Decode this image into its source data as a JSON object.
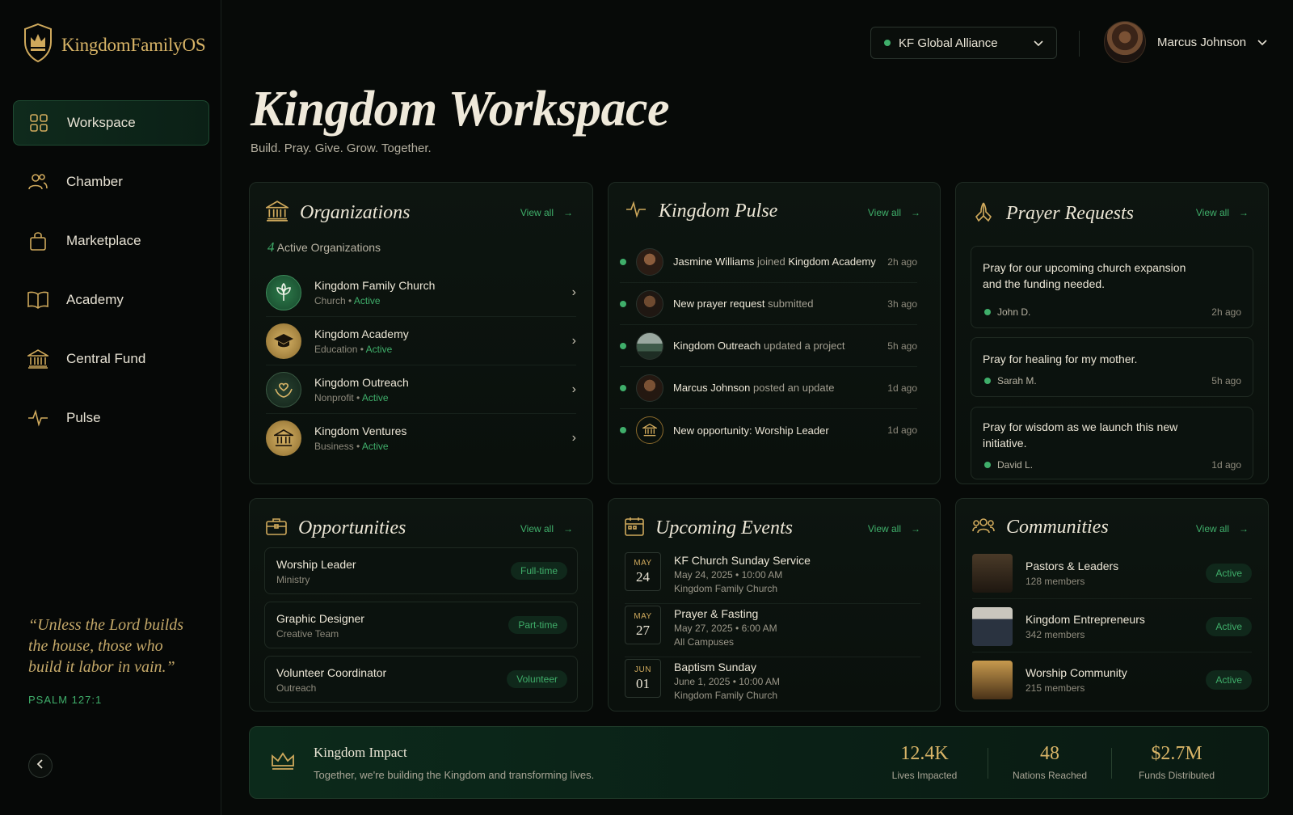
{
  "app": {
    "name": "KingdomFamilyOS",
    "accent": "#cfa95c",
    "green": "#3fae6a"
  },
  "sidebar": {
    "items": [
      {
        "label": "Workspace",
        "icon": "grid-icon",
        "active": true
      },
      {
        "label": "Chamber",
        "icon": "people-icon"
      },
      {
        "label": "Marketplace",
        "icon": "bag-icon"
      },
      {
        "label": "Academy",
        "icon": "book-icon"
      },
      {
        "label": "Central Fund",
        "icon": "bank-icon"
      },
      {
        "label": "Pulse",
        "icon": "pulse-icon"
      }
    ],
    "quote": "“Unless the Lord builds the house, those who build it labor in vain.”",
    "quote_ref": "PSALM 127:1"
  },
  "topbar": {
    "org": "KF Global Alliance",
    "user": "Marcus Johnson"
  },
  "header": {
    "title": "Kingdom Workspace",
    "subtitle": "Build. Pray. Give. Grow. Together."
  },
  "organizations": {
    "title": "Organizations",
    "view_all": "View all",
    "count": "4",
    "count_label": "Active Organizations",
    "items": [
      {
        "name": "Kingdom Family Church",
        "type": "Church",
        "status": "Active"
      },
      {
        "name": "Kingdom Academy",
        "type": "Education",
        "status": "Active"
      },
      {
        "name": "Kingdom Outreach",
        "type": "Nonprofit",
        "status": "Active"
      },
      {
        "name": "Kingdom Ventures",
        "type": "Business",
        "status": "Active"
      }
    ]
  },
  "pulse": {
    "title": "Kingdom Pulse",
    "view_all": "View all",
    "items": [
      {
        "who": "Jasmine Williams",
        "action": " joined ",
        "target": "Kingdom Academy",
        "ago": "2h ago"
      },
      {
        "who": "New prayer request",
        "action": " submitted",
        "target": "",
        "ago": "3h ago"
      },
      {
        "who": "Kingdom Outreach",
        "action": " updated a project",
        "target": "",
        "ago": "5h ago"
      },
      {
        "who": "Marcus Johnson",
        "action": " posted an update",
        "target": "",
        "ago": "1d ago"
      },
      {
        "who": "New opportunity: Worship Leader",
        "action": "",
        "target": "",
        "ago": "1d ago"
      }
    ]
  },
  "prayer": {
    "title": "Prayer Requests",
    "view_all": "View all",
    "items": [
      {
        "text": "Pray for our upcoming church expansion and the funding needed.",
        "name": "John D.",
        "ago": "2h ago"
      },
      {
        "text": "Pray for healing for my mother.",
        "name": "Sarah M.",
        "ago": "5h ago"
      },
      {
        "text": "Pray for wisdom as we launch this new initiative.",
        "name": "David L.",
        "ago": "1d ago"
      }
    ]
  },
  "opportunities": {
    "title": "Opportunities",
    "view_all": "View all",
    "items": [
      {
        "title": "Worship Leader",
        "dept": "Ministry",
        "tag": "Full-time"
      },
      {
        "title": "Graphic Designer",
        "dept": "Creative Team",
        "tag": "Part-time"
      },
      {
        "title": "Volunteer Coordinator",
        "dept": "Outreach",
        "tag": "Volunteer"
      }
    ]
  },
  "events": {
    "title": "Upcoming Events",
    "view_all": "View all",
    "items": [
      {
        "month": "MAY",
        "day": "24",
        "title": "KF Church Sunday Service",
        "when": "May 24, 2025 • 10:00 AM",
        "where": "Kingdom Family Church"
      },
      {
        "month": "MAY",
        "day": "27",
        "title": "Prayer & Fasting",
        "when": "May 27, 2025 • 6:00 AM",
        "where": "All Campuses"
      },
      {
        "month": "JUN",
        "day": "01",
        "title": "Baptism Sunday",
        "when": "June 1, 2025 • 10:00 AM",
        "where": "Kingdom Family Church"
      }
    ]
  },
  "communities": {
    "title": "Communities",
    "view_all": "View all",
    "items": [
      {
        "name": "Pastors & Leaders",
        "members": "128 members",
        "status": "Active"
      },
      {
        "name": "Kingdom Entrepreneurs",
        "members": "342 members",
        "status": "Active"
      },
      {
        "name": "Worship Community",
        "members": "215 members",
        "status": "Active"
      }
    ]
  },
  "impact": {
    "title": "Kingdom Impact",
    "subtitle": "Together, we're building the Kingdom and transforming lives.",
    "stats": [
      {
        "value": "12.4K",
        "label": "Lives Impacted"
      },
      {
        "value": "48",
        "label": "Nations Reached"
      },
      {
        "value": "$2.7M",
        "label": "Funds Distributed"
      }
    ]
  }
}
